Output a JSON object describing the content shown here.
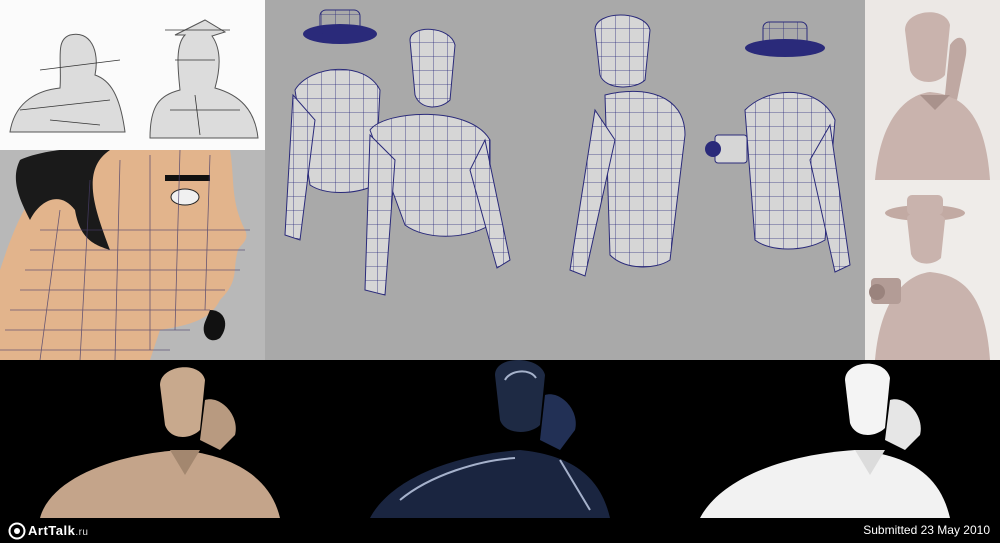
{
  "footer": {
    "logo_name": "ArtTalk",
    "logo_tld": ".ru",
    "submitted": "Submitted 23 May 2010"
  },
  "colors": {
    "wireframe_bg": "#a9a9a9",
    "wire_lines": "#2a2a7a",
    "skin": "#e2b48c",
    "clay": "#c9b3ad",
    "chrome": "#1e2a44"
  },
  "icons": [
    "arttalk-logo-icon"
  ]
}
